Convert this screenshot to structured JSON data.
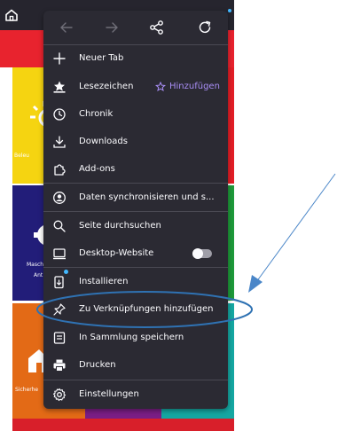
{
  "background_app": {
    "tiles": [
      {
        "label": "Beleu",
        "color": "#f5d411"
      },
      {
        "label": "Masch",
        "color": "#221d79"
      },
      {
        "label": "Ant",
        "color": "#221d79"
      },
      {
        "label": "Sicherhe",
        "color": "#e36a16"
      }
    ],
    "icons": [
      "home-icon",
      "lightbulb-icon",
      "gear-icon",
      "house-icon"
    ]
  },
  "menu": {
    "toolbar": {
      "icons": [
        "back-arrow-icon",
        "forward-arrow-icon",
        "share-icon",
        "reload-icon"
      ]
    },
    "items": [
      {
        "label": "Neuer Tab",
        "icon": "plus-icon"
      },
      {
        "label": "Lesezeichen",
        "icon": "bookmarks-icon",
        "action_label": "Hinzufügen",
        "action_icon": "star-outline-icon",
        "action_color": "#a98ef6"
      },
      {
        "label": "Chronik",
        "icon": "history-clock-icon"
      },
      {
        "label": "Downloads",
        "icon": "download-icon"
      },
      {
        "label": "Add-ons",
        "icon": "puzzle-icon"
      },
      {
        "label": "Daten synchronisieren und s...",
        "icon": "account-icon"
      },
      {
        "label": "Seite durchsuchen",
        "icon": "search-icon"
      },
      {
        "label": "Desktop-Website",
        "icon": "desktop-icon",
        "toggle": false
      },
      {
        "label": "Installieren",
        "icon": "install-icon"
      },
      {
        "label": "Zu Verknüpfungen hinzufügen",
        "icon": "pin-icon"
      },
      {
        "label": "In Sammlung speichern",
        "icon": "collection-icon"
      },
      {
        "label": "Drucken",
        "icon": "print-icon"
      },
      {
        "label": "Einstellungen",
        "icon": "settings-gear-icon"
      }
    ]
  },
  "colors": {
    "menu_background": "#2b2a33",
    "menu_text": "#fbfbfe",
    "accent": "#a98ef6",
    "annotation": "#4a86c8"
  }
}
